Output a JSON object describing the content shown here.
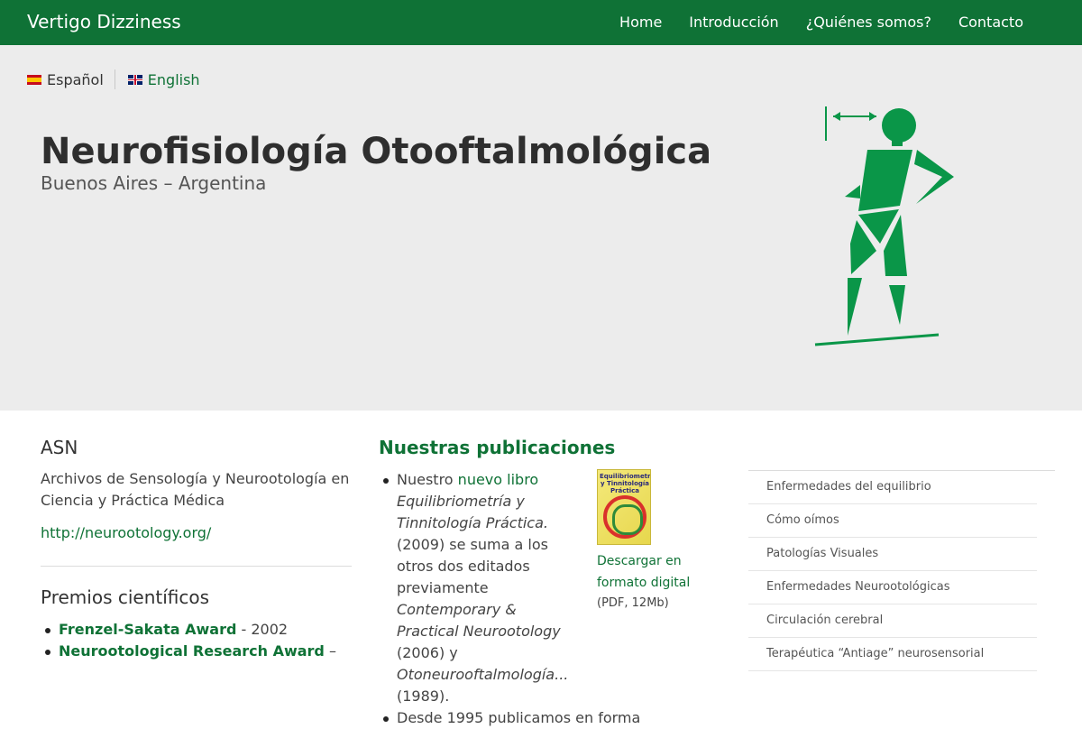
{
  "navbar": {
    "brand": "Vertigo Dizziness",
    "links": [
      "Home",
      "Introducción",
      "¿Quiénes somos?",
      "Contacto"
    ]
  },
  "language": {
    "spanish": "Español",
    "english": "English"
  },
  "hero": {
    "title": "Neurofisiología Otooftalmológica",
    "subtitle": "Buenos Aires – Argentina"
  },
  "asn": {
    "title": "ASN",
    "description": "Archivos de Sensología y Neurootología en Ciencia y Práctica Médica",
    "url": "http://neurootology.org/"
  },
  "awards": {
    "title": "Premios científicos",
    "items": [
      {
        "name": "Frenzel-Sakata Award",
        "detail": " - 2002"
      },
      {
        "name": "Neurootological Research Award",
        "detail": " –"
      }
    ]
  },
  "publications": {
    "title": "Nuestras publicaciones",
    "item1": {
      "intro": "Nuestro ",
      "link": "nuevo libro",
      "book_title": "Equilibriometría y Tinnitología Práctica.",
      "book_year": " (2009) se suma a los otros dos editados previamente ",
      "book2": "Contemporary & Practical Neurootology",
      "book2_year": " (2006) y ",
      "book3": "Otoneurooftalmología...",
      "book3_year": " (1989)."
    },
    "item2": "Desde 1995 publicamos en forma",
    "cover_title": "Equilibriometría y Tinnitología Práctica",
    "download_link": "Descargar en formato digital",
    "download_size": "(PDF, 12Mb)"
  },
  "sidebar_menu": [
    "Enfermedades del equilibrio",
    "Cómo oímos",
    "Patologías Visuales",
    "Enfermedades Neurootológicas",
    "Circulación cerebral",
    "Terapéutica “Antiage” neurosensorial"
  ],
  "colors": {
    "brand_green": "#0f7236",
    "figure_green": "#0a9648",
    "hero_bg": "#ececec"
  }
}
